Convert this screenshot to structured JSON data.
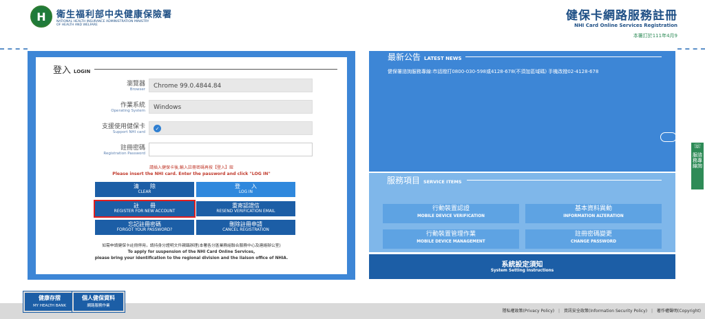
{
  "header": {
    "org_zh": "衛生福利部中央健康保險署",
    "org_en1": "NATIONAL HEALTH INSURANCE ADMINISTRATION MINISTRY",
    "org_en2": "OF HEALTH AND WELFARE",
    "site_title_zh": "健保卡網路服務註冊",
    "site_title_en": "NHI Card Online Services Registration",
    "revised": "本署訂於111年4月9"
  },
  "login": {
    "heading_zh": "登入",
    "heading_en": "LOGIN",
    "browser_label_zh": "瀏覽器",
    "browser_label_en": "Browser",
    "browser_value": "Chrome 99.0.4844.84",
    "os_label_zh": "作業系統",
    "os_label_en": "Operating System",
    "os_value": "Windows",
    "card_label_zh": "支援使用健保卡",
    "card_label_en": "Support NHI card",
    "password_label_zh": "註冊密碼",
    "password_label_en": "Registration Password",
    "password_value": "",
    "tip_zh": "請插入健保卡後,輸入註冊密碼再按【登入】鈕",
    "tip_en": "Please insert the NHI card. Enter the password and click \"LOG IN\"",
    "buttons": {
      "clear_zh": "清　　除",
      "clear_en": "CLEAR",
      "login_zh": "登　　入",
      "login_en": "LOG IN",
      "register_zh": "註　　冊",
      "register_en": "REGISTER FOR NEW ACCOUNT",
      "resend_zh": "重寄認證信",
      "resend_en": "RESEND VERIFICATION EMAIL",
      "forgot_zh": "忘記註冊密碼",
      "forgot_en": "FORGOT YOUR PASSWORD?",
      "cancel_zh": "刪除註冊申請",
      "cancel_en": "CANCEL REGISTRATION"
    },
    "note_zh": "如需申請健保卡註冊停用，請持身分證明文件親臨辦理(本署各分區業務組聯合服務中心及連絡辦公室)",
    "note_en1": "To apply for suspension of the NHI Card Online Services,",
    "note_en2": "please bring your identification to the regional division and the liaison office of NHIA."
  },
  "news": {
    "heading_zh": "最新公告",
    "heading_en": "LATEST NEWS",
    "item": "健保署諮詢服務專線:市話撥打0800-030-598或4128-678(不須加區域碼) 手機改撥02-4128-678"
  },
  "services": {
    "heading_zh": "服務項目",
    "heading_en": "SERVICE ITEMS",
    "items": [
      {
        "zh": "行動裝置認證",
        "en": "MOBILE DEVICE VERIFICATION"
      },
      {
        "zh": "基本資料異動",
        "en": "INFORMATION ALTERATION"
      },
      {
        "zh": "行動裝置管理作業",
        "en": "MOBILE DEVICE MANAGEMENT"
      },
      {
        "zh": "註冊密碼變更",
        "en": "CHANGE PASSWORD"
      }
    ]
  },
  "settings": {
    "zh": "系統設定須知",
    "en": "System Setting Instructions"
  },
  "side_tab": {
    "label": "服諮務專線詢"
  },
  "bottom": {
    "health_bank_zh": "健康存摺",
    "health_bank_en": "MY HEALTH BANK",
    "personal_zh": "個人健保資料",
    "personal_en": "網路服務作業"
  },
  "footer": {
    "privacy": "隱私權政策(Privacy Policy)",
    "security": "資訊安全政策(Information Security Policy)",
    "copyright": "著作權聲明(Copyright)"
  },
  "colors": {
    "primary": "#3d86d6",
    "dark_button": "#1c5ea6",
    "light_button": "#2f88dd",
    "services_bg": "#7fb7ea",
    "highlight": "#e01e1e",
    "green": "#2e8b57"
  }
}
